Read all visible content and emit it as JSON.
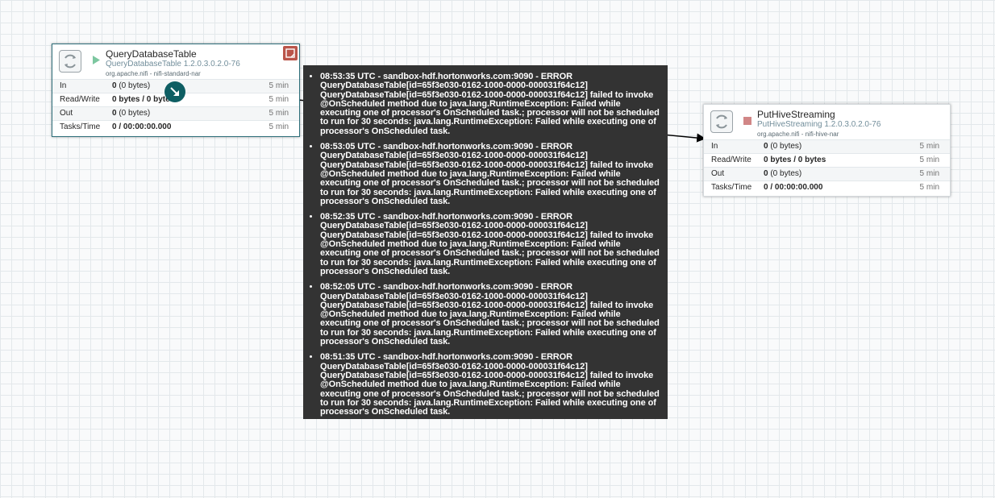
{
  "processors": [
    {
      "name": "QueryDatabaseTable",
      "type": "QueryDatabaseTable 1.2.0.3.0.2.0-76",
      "bundle": "org.apache.nifi - nifi-standard-nar",
      "status_icon": "play-icon",
      "stats": [
        {
          "label": "In",
          "value": "0",
          "sub": "(0 bytes)",
          "time": "5 min"
        },
        {
          "label": "Read/Write",
          "value": "0 bytes / 0 bytes",
          "sub": "",
          "time": "5 min"
        },
        {
          "label": "Out",
          "value": "0",
          "sub": "(0 bytes)",
          "time": "5 min"
        },
        {
          "label": "Tasks/Time",
          "value": "0 / 00:00:00.000",
          "sub": "",
          "time": "5 min"
        }
      ]
    },
    {
      "name": "PutHiveStreaming",
      "type": "PutHiveStreaming 1.2.0.3.0.2.0-76",
      "bundle": "org.apache.nifi - nifi-hive-nar",
      "status_icon": "stop-icon",
      "stats": [
        {
          "label": "In",
          "value": "0",
          "sub": "(0 bytes)",
          "time": "5 min"
        },
        {
          "label": "Read/Write",
          "value": "0 bytes / 0 bytes",
          "sub": "",
          "time": "5 min"
        },
        {
          "label": "Out",
          "value": "0",
          "sub": "(0 bytes)",
          "time": "5 min"
        },
        {
          "label": "Tasks/Time",
          "value": "0 / 00:00:00.000",
          "sub": "",
          "time": "5 min"
        }
      ]
    }
  ],
  "bulletins": [
    {
      "header": "08:53:35 UTC - sandbox-hdf.hortonworks.com:9090 -  ERROR",
      "lines": [
        "QueryDatabaseTable[id=65f3e030-0162-1000-0000-000031f64c12]",
        "QueryDatabaseTable[id=65f3e030-0162-1000-0000-000031f64c12] failed to invoke @OnScheduled method due to java.lang.RuntimeException: Failed while executing one of processor's OnScheduled task.; processor will not be scheduled to run for 30 seconds: java.lang.RuntimeException: Failed while executing one of processor's OnScheduled task."
      ]
    },
    {
      "header": "08:53:05 UTC - sandbox-hdf.hortonworks.com:9090 -  ERROR",
      "lines": [
        "QueryDatabaseTable[id=65f3e030-0162-1000-0000-000031f64c12]",
        "QueryDatabaseTable[id=65f3e030-0162-1000-0000-000031f64c12] failed to invoke @OnScheduled method due to java.lang.RuntimeException: Failed while executing one of processor's OnScheduled task.; processor will not be scheduled to run for 30 seconds: java.lang.RuntimeException: Failed while executing one of processor's OnScheduled task."
      ]
    },
    {
      "header": "08:52:35 UTC - sandbox-hdf.hortonworks.com:9090 -  ERROR",
      "lines": [
        "QueryDatabaseTable[id=65f3e030-0162-1000-0000-000031f64c12]",
        "QueryDatabaseTable[id=65f3e030-0162-1000-0000-000031f64c12] failed to invoke @OnScheduled method due to java.lang.RuntimeException: Failed while executing one of processor's OnScheduled task.; processor will not be scheduled to run for 30 seconds: java.lang.RuntimeException: Failed while executing one of processor's OnScheduled task."
      ]
    },
    {
      "header": "08:52:05 UTC - sandbox-hdf.hortonworks.com:9090 -  ERROR",
      "lines": [
        "QueryDatabaseTable[id=65f3e030-0162-1000-0000-000031f64c12]",
        "QueryDatabaseTable[id=65f3e030-0162-1000-0000-000031f64c12] failed to invoke @OnScheduled method due to java.lang.RuntimeException: Failed while executing one of processor's OnScheduled task.; processor will not be scheduled to run for 30 seconds: java.lang.RuntimeException: Failed while executing one of processor's OnScheduled task."
      ]
    },
    {
      "header": "08:51:35 UTC - sandbox-hdf.hortonworks.com:9090 -  ERROR",
      "lines": [
        "QueryDatabaseTable[id=65f3e030-0162-1000-0000-000031f64c12]",
        "QueryDatabaseTable[id=65f3e030-0162-1000-0000-000031f64c12] failed to invoke @OnScheduled method due to java.lang.RuntimeException: Failed while executing one of processor's OnScheduled task.; processor will not be scheduled to run for 30 seconds: java.lang.RuntimeException: Failed while executing one of processor's OnScheduled task."
      ]
    }
  ],
  "colors": {
    "accent": "#0e5e63",
    "play": "#7dc7a0",
    "stop": "#d18686",
    "bulletin": "#ba554a",
    "tooltip_bg": "#333333"
  }
}
